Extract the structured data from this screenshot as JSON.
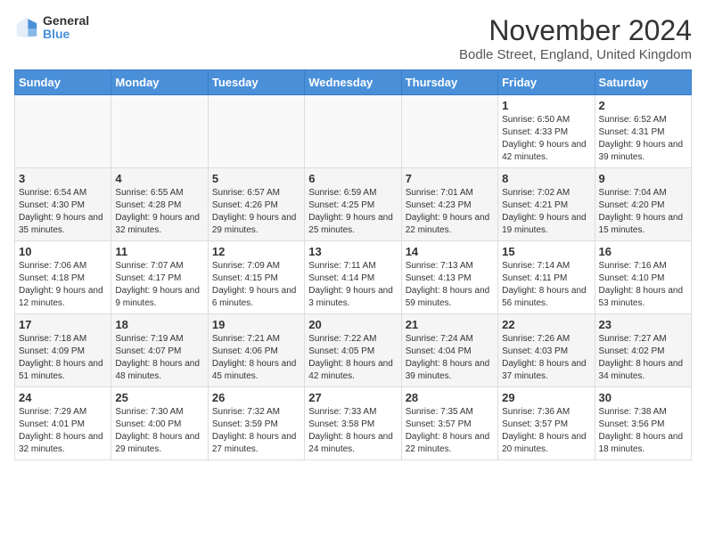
{
  "header": {
    "logo_general": "General",
    "logo_blue": "Blue",
    "title": "November 2024",
    "subtitle": "Bodle Street, England, United Kingdom"
  },
  "days_of_week": [
    "Sunday",
    "Monday",
    "Tuesday",
    "Wednesday",
    "Thursday",
    "Friday",
    "Saturday"
  ],
  "weeks": [
    [
      {
        "day": "",
        "info": ""
      },
      {
        "day": "",
        "info": ""
      },
      {
        "day": "",
        "info": ""
      },
      {
        "day": "",
        "info": ""
      },
      {
        "day": "",
        "info": ""
      },
      {
        "day": "1",
        "info": "Sunrise: 6:50 AM\nSunset: 4:33 PM\nDaylight: 9 hours and 42 minutes."
      },
      {
        "day": "2",
        "info": "Sunrise: 6:52 AM\nSunset: 4:31 PM\nDaylight: 9 hours and 39 minutes."
      }
    ],
    [
      {
        "day": "3",
        "info": "Sunrise: 6:54 AM\nSunset: 4:30 PM\nDaylight: 9 hours and 35 minutes."
      },
      {
        "day": "4",
        "info": "Sunrise: 6:55 AM\nSunset: 4:28 PM\nDaylight: 9 hours and 32 minutes."
      },
      {
        "day": "5",
        "info": "Sunrise: 6:57 AM\nSunset: 4:26 PM\nDaylight: 9 hours and 29 minutes."
      },
      {
        "day": "6",
        "info": "Sunrise: 6:59 AM\nSunset: 4:25 PM\nDaylight: 9 hours and 25 minutes."
      },
      {
        "day": "7",
        "info": "Sunrise: 7:01 AM\nSunset: 4:23 PM\nDaylight: 9 hours and 22 minutes."
      },
      {
        "day": "8",
        "info": "Sunrise: 7:02 AM\nSunset: 4:21 PM\nDaylight: 9 hours and 19 minutes."
      },
      {
        "day": "9",
        "info": "Sunrise: 7:04 AM\nSunset: 4:20 PM\nDaylight: 9 hours and 15 minutes."
      }
    ],
    [
      {
        "day": "10",
        "info": "Sunrise: 7:06 AM\nSunset: 4:18 PM\nDaylight: 9 hours and 12 minutes."
      },
      {
        "day": "11",
        "info": "Sunrise: 7:07 AM\nSunset: 4:17 PM\nDaylight: 9 hours and 9 minutes."
      },
      {
        "day": "12",
        "info": "Sunrise: 7:09 AM\nSunset: 4:15 PM\nDaylight: 9 hours and 6 minutes."
      },
      {
        "day": "13",
        "info": "Sunrise: 7:11 AM\nSunset: 4:14 PM\nDaylight: 9 hours and 3 minutes."
      },
      {
        "day": "14",
        "info": "Sunrise: 7:13 AM\nSunset: 4:13 PM\nDaylight: 8 hours and 59 minutes."
      },
      {
        "day": "15",
        "info": "Sunrise: 7:14 AM\nSunset: 4:11 PM\nDaylight: 8 hours and 56 minutes."
      },
      {
        "day": "16",
        "info": "Sunrise: 7:16 AM\nSunset: 4:10 PM\nDaylight: 8 hours and 53 minutes."
      }
    ],
    [
      {
        "day": "17",
        "info": "Sunrise: 7:18 AM\nSunset: 4:09 PM\nDaylight: 8 hours and 51 minutes."
      },
      {
        "day": "18",
        "info": "Sunrise: 7:19 AM\nSunset: 4:07 PM\nDaylight: 8 hours and 48 minutes."
      },
      {
        "day": "19",
        "info": "Sunrise: 7:21 AM\nSunset: 4:06 PM\nDaylight: 8 hours and 45 minutes."
      },
      {
        "day": "20",
        "info": "Sunrise: 7:22 AM\nSunset: 4:05 PM\nDaylight: 8 hours and 42 minutes."
      },
      {
        "day": "21",
        "info": "Sunrise: 7:24 AM\nSunset: 4:04 PM\nDaylight: 8 hours and 39 minutes."
      },
      {
        "day": "22",
        "info": "Sunrise: 7:26 AM\nSunset: 4:03 PM\nDaylight: 8 hours and 37 minutes."
      },
      {
        "day": "23",
        "info": "Sunrise: 7:27 AM\nSunset: 4:02 PM\nDaylight: 8 hours and 34 minutes."
      }
    ],
    [
      {
        "day": "24",
        "info": "Sunrise: 7:29 AM\nSunset: 4:01 PM\nDaylight: 8 hours and 32 minutes."
      },
      {
        "day": "25",
        "info": "Sunrise: 7:30 AM\nSunset: 4:00 PM\nDaylight: 8 hours and 29 minutes."
      },
      {
        "day": "26",
        "info": "Sunrise: 7:32 AM\nSunset: 3:59 PM\nDaylight: 8 hours and 27 minutes."
      },
      {
        "day": "27",
        "info": "Sunrise: 7:33 AM\nSunset: 3:58 PM\nDaylight: 8 hours and 24 minutes."
      },
      {
        "day": "28",
        "info": "Sunrise: 7:35 AM\nSunset: 3:57 PM\nDaylight: 8 hours and 22 minutes."
      },
      {
        "day": "29",
        "info": "Sunrise: 7:36 AM\nSunset: 3:57 PM\nDaylight: 8 hours and 20 minutes."
      },
      {
        "day": "30",
        "info": "Sunrise: 7:38 AM\nSunset: 3:56 PM\nDaylight: 8 hours and 18 minutes."
      }
    ]
  ]
}
